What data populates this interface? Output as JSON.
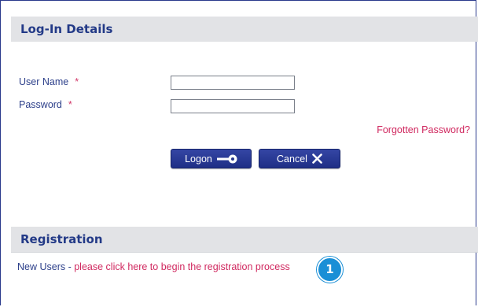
{
  "login": {
    "section_title": "Log-In Details",
    "username_label": "User Name",
    "username_value": "",
    "password_label": "Password",
    "password_value": "",
    "required_marker": "*",
    "forgot_password_link": "Forgotten Password?",
    "logon_button": "Logon",
    "cancel_button": "Cancel",
    "logon_icon": "key-icon",
    "cancel_icon": "close-x-icon"
  },
  "registration": {
    "section_title": "Registration",
    "new_users_text": "New Users - ",
    "register_link": "please click here to begin the registration process"
  },
  "callout": {
    "number": "1"
  },
  "colors": {
    "header_bg": "#e2e3e6",
    "heading_text": "#233a87",
    "link": "#d0285f",
    "button": "#2a3c98",
    "badge": "#1a8fd6"
  }
}
